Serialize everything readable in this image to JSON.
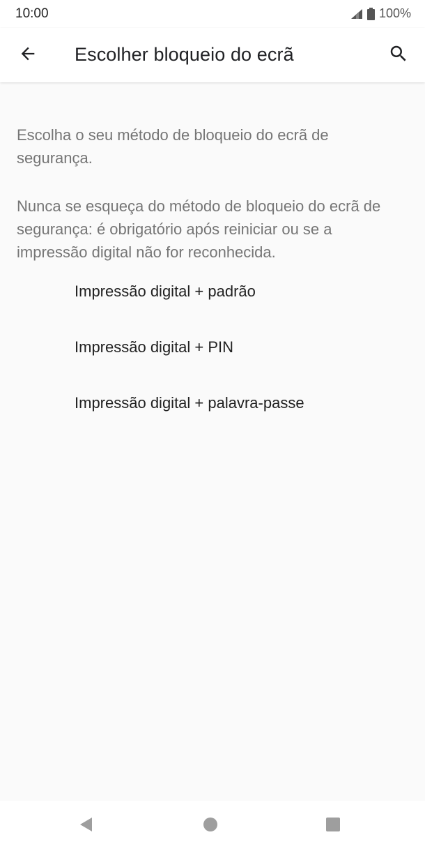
{
  "status_bar": {
    "time": "10:00",
    "battery": "100%",
    "icons": [
      "signal-icon",
      "battery-icon"
    ]
  },
  "header": {
    "title": "Escolher bloqueio do ecrã",
    "back_icon": "arrow-back-icon",
    "search_icon": "search-icon"
  },
  "main": {
    "description_1": "Escolha o seu método de bloqueio do ecrã de segurança.",
    "description_2": "Nunca se esqueça do método de bloqueio do ecrã de segurança: é obrigatório após reiniciar ou se a impressão digital não for reconhecida.",
    "options": [
      {
        "label": "Impressão digital + padrão"
      },
      {
        "label": "Impressão digital + PIN"
      },
      {
        "label": "Impressão digital + palavra-passe"
      }
    ]
  },
  "nav_bar": {
    "icons": [
      "nav-back-icon",
      "nav-home-icon",
      "nav-recents-icon"
    ]
  },
  "colors": {
    "background": "#fafafa",
    "secondary_text": "#757575",
    "primary_text": "#212121",
    "nav_icon": "#9e9e9e"
  }
}
